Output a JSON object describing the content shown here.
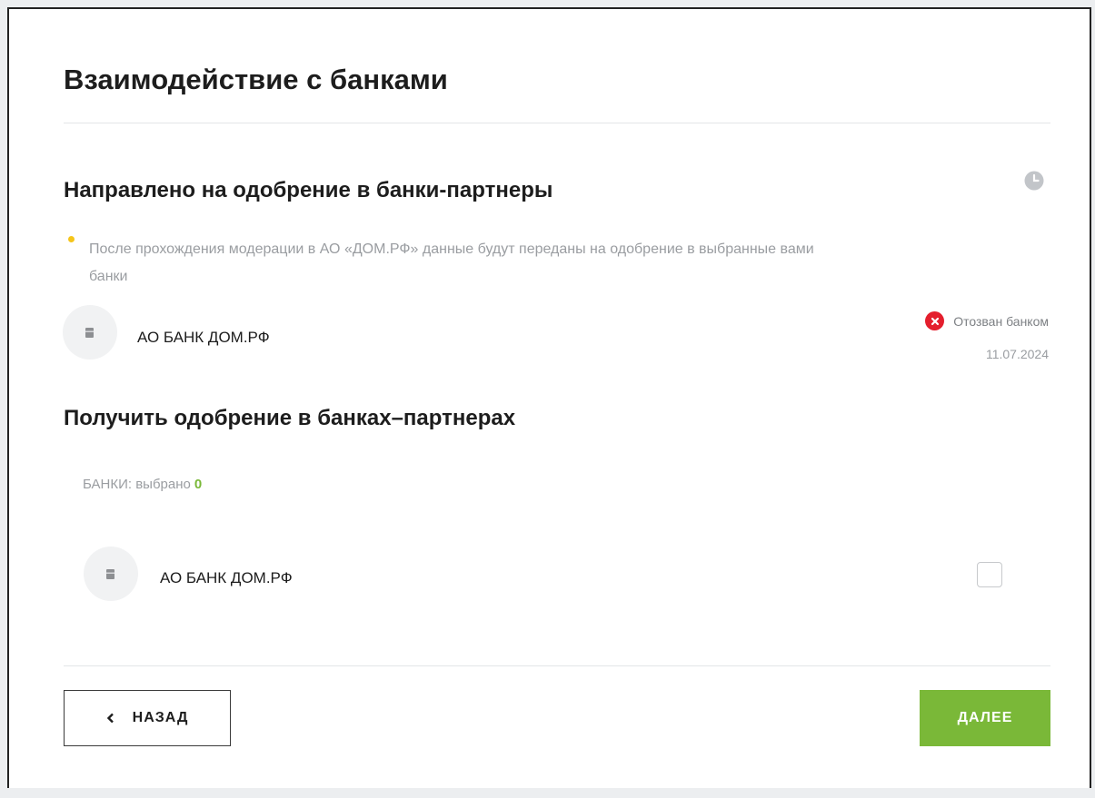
{
  "page": {
    "title": "Взаимодействие с банками"
  },
  "sent_section": {
    "title": "Направлено на одобрение в банки-партнеры",
    "note_line1": "После прохождения модерации в АО «ДОМ.РФ» данные будут переданы на одобрение в выбранные вами",
    "note_line2": "банки",
    "bank": {
      "name": "АО БАНК ДОМ.РФ",
      "status": "Отозван банком",
      "date": "11.07.2024"
    }
  },
  "get_section": {
    "title": "Получить одобрение в банках–партнерах",
    "counter_label": "БАНКИ: выбрано",
    "counter_value": "0",
    "bank": {
      "name": "АО БАНК ДОМ.РФ",
      "checked": false
    }
  },
  "buttons": {
    "back": "НАЗАД",
    "next": "ДАЛЕЕ"
  },
  "colors": {
    "accent": "#7ab838",
    "status_error": "#e41e2d",
    "note_dot": "#f5c51a"
  },
  "icons": {
    "history": "clock-icon",
    "status": "close-circle-icon",
    "back": "chevron-left-icon"
  }
}
